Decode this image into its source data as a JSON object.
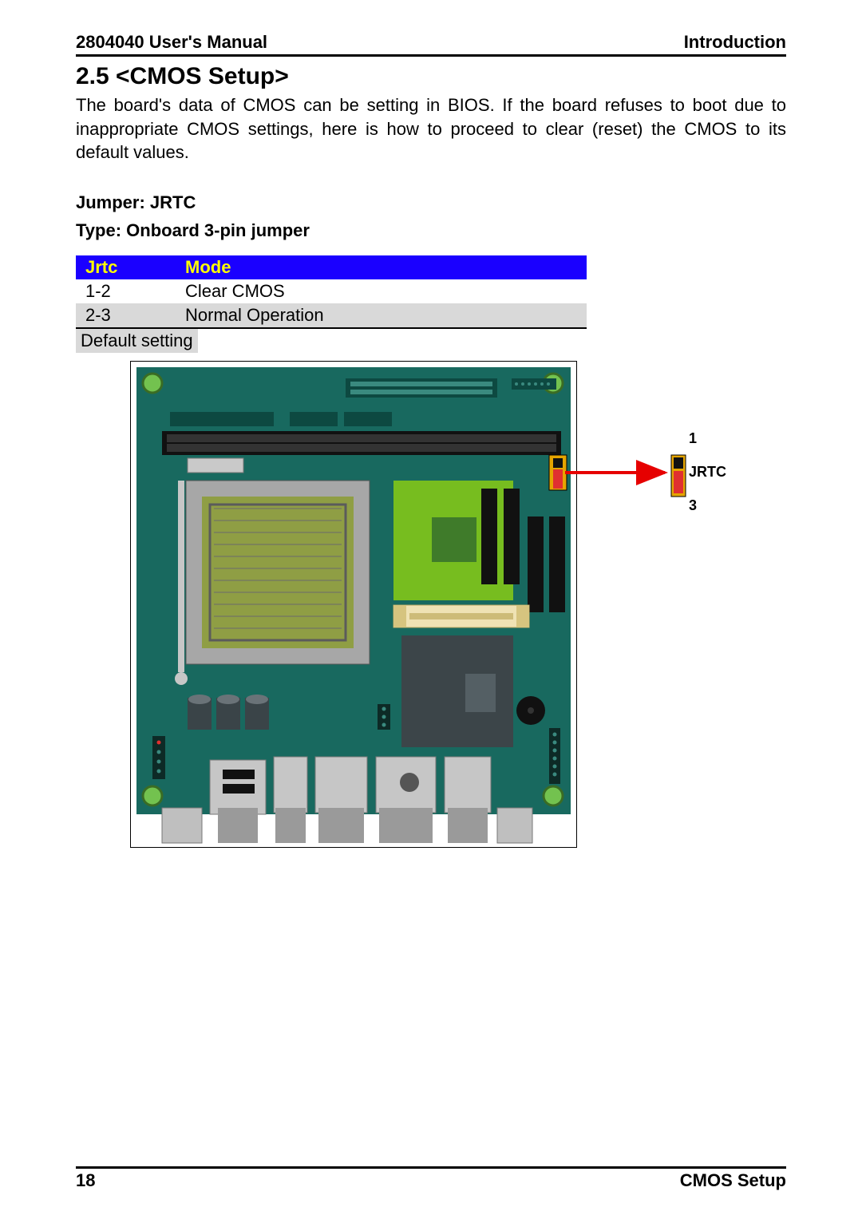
{
  "header": {
    "left": "2804040 User's Manual",
    "right": "Introduction"
  },
  "section_title": "2.5 <CMOS Setup>",
  "body_text": "The board's data of CMOS can be setting in BIOS. If the board refuses to boot due to inappropriate CMOS settings, here is how to proceed to clear (reset) the CMOS to its default values.",
  "jumper_label": "Jumper: JRTC",
  "type_label": "Type: Onboard 3-pin jumper",
  "table": {
    "headers": {
      "col1": "Jrtc",
      "col2": "Mode"
    },
    "rows": [
      {
        "col1": "1-2",
        "col2": "Clear CMOS"
      },
      {
        "col1": "2-3",
        "col2": "Normal Operation"
      }
    ]
  },
  "default_setting": "Default setting",
  "callout": {
    "pin1": "1",
    "jrtc": "JRTC",
    "pin3": "3"
  },
  "footer": {
    "left": "18",
    "right": "CMOS Setup"
  }
}
